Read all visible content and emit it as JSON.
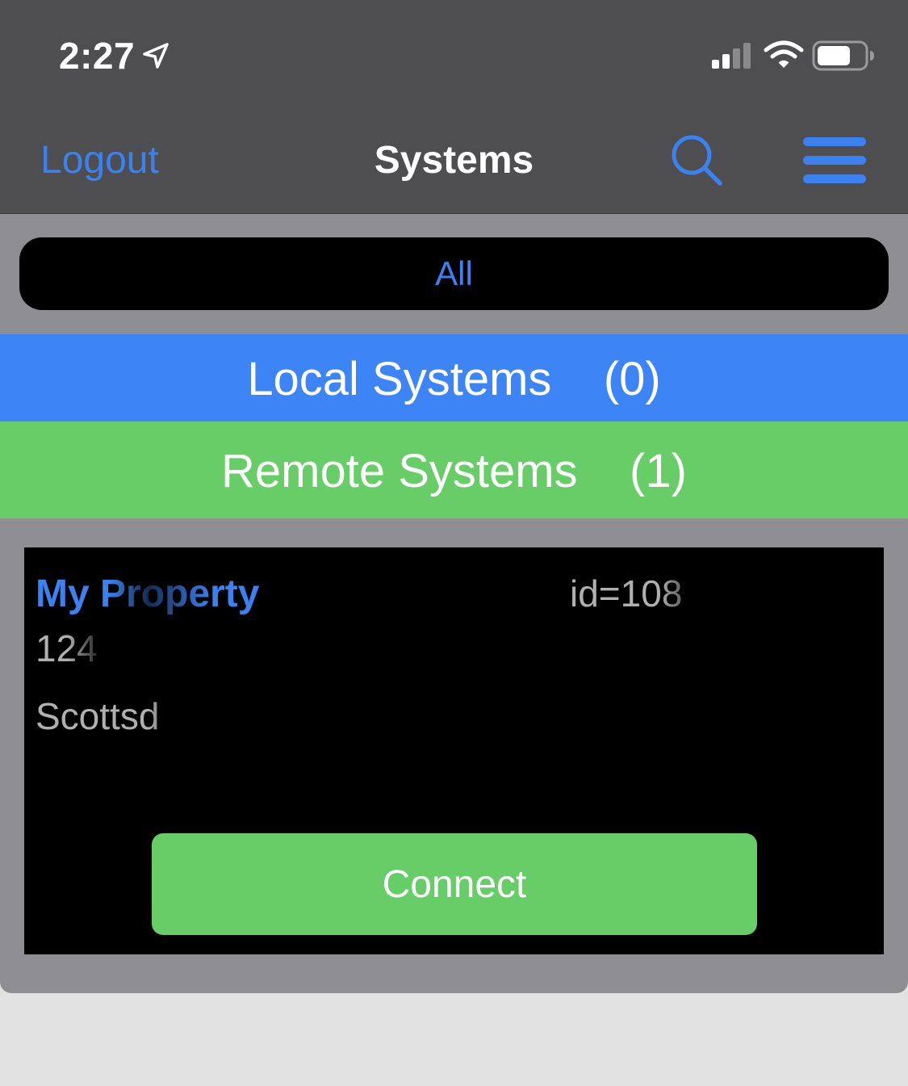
{
  "status_bar": {
    "time": "2:27",
    "icons": [
      "location-arrow-icon",
      "cellular-signal-icon",
      "wifi-icon",
      "battery-icon"
    ]
  },
  "nav": {
    "logout_label": "Logout",
    "title": "Systems",
    "search_icon": "search-icon",
    "menu_icon": "hamburger-menu-icon"
  },
  "filter": {
    "selected_label": "All"
  },
  "sections": {
    "local": {
      "label": "Local Systems    (0)"
    },
    "remote": {
      "label": "Remote Systems    (1)"
    }
  },
  "systems": [
    {
      "name": "My Property",
      "id": "id=108",
      "street": "124",
      "city": "Scottsd",
      "connect_label": "Connect"
    }
  ],
  "colors": {
    "accent_blue": "#3b82f0",
    "local_header": "#3d84f6",
    "remote_green": "#67cd67",
    "bar_gray": "#4e4e50",
    "panel_gray": "#8e8e93"
  }
}
